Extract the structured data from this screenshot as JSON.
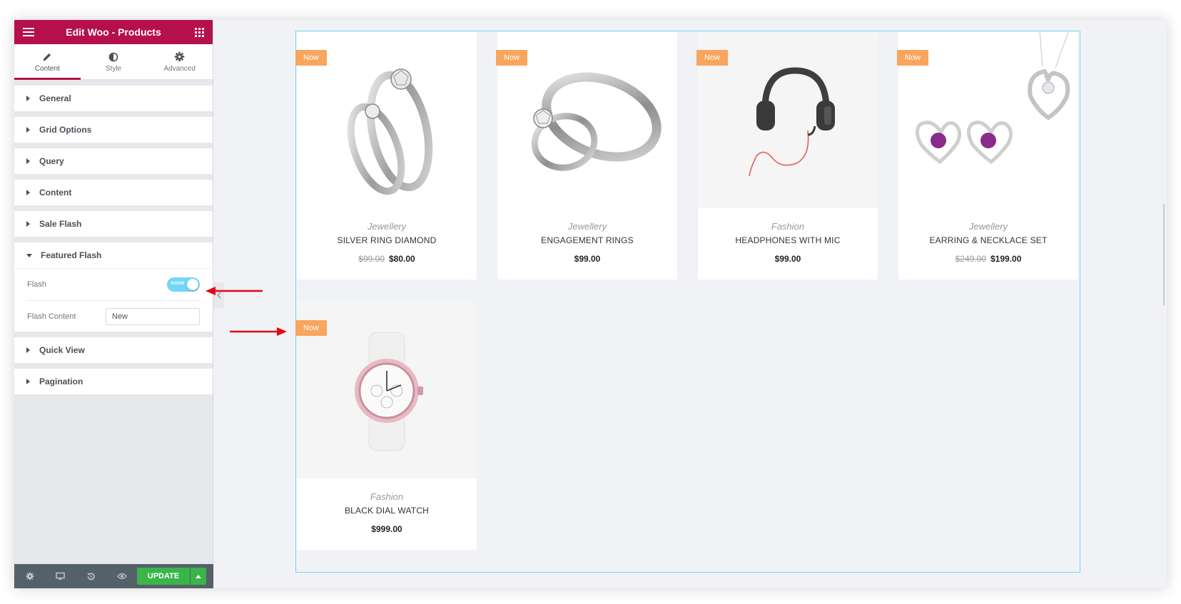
{
  "panel": {
    "title": "Edit Woo - Products",
    "tabs": [
      {
        "label": "Content",
        "icon": "pencil-icon"
      },
      {
        "label": "Style",
        "icon": "half-circle-icon"
      },
      {
        "label": "Advanced",
        "icon": "gear-icon"
      }
    ],
    "sections": {
      "general": "General",
      "grid_options": "Grid Options",
      "query": "Query",
      "content": "Content",
      "sale_flash": "Sale Flash",
      "featured_flash": "Featured Flash",
      "quick_view": "Quick View",
      "pagination": "Pagination"
    },
    "featured_flash": {
      "flash_label": "Flash",
      "flash_toggle_text": "SHOW",
      "flash_toggle_on": true,
      "flash_content_label": "Flash Content",
      "flash_content_value": "New"
    },
    "footer": {
      "update_label": "UPDATE"
    }
  },
  "products": [
    {
      "badge": "Now",
      "category": "Jewellery",
      "name": "SILVER RING DIAMOND",
      "old_price": "$99.00",
      "price": "$80.00"
    },
    {
      "badge": "Now",
      "category": "Jewellery",
      "name": "ENGAGEMENT RINGS",
      "old_price": "",
      "price": "$99.00"
    },
    {
      "badge": "Now",
      "category": "Fashion",
      "name": "HEADPHONES WITH MIC",
      "old_price": "",
      "price": "$99.00"
    },
    {
      "badge": "Now",
      "category": "Jewellery",
      "name": "EARRING & NECKLACE SET",
      "old_price": "$249.00",
      "price": "$199.00"
    },
    {
      "badge": "Now",
      "category": "Fashion",
      "name": "BLACK DIAL WATCH",
      "old_price": "",
      "price": "$999.00"
    }
  ],
  "colors": {
    "brand": "#b5104c",
    "badge": "#f9a55d",
    "update": "#39b54a",
    "toggle": "#71d7f7",
    "annotation_arrow": "#e30613"
  }
}
